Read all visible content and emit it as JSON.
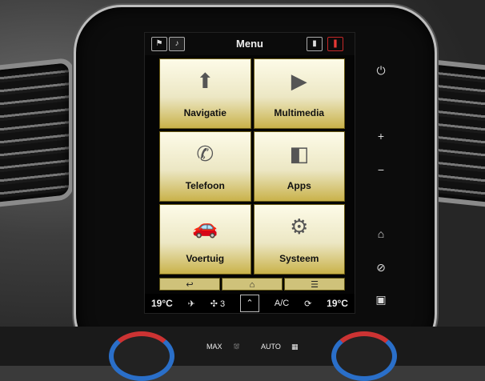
{
  "header": {
    "title": "Menu",
    "left_icons": [
      "road-sign-icon",
      "audio-icon"
    ],
    "right_icons": [
      "phone-battery-icon",
      "signal-icon"
    ]
  },
  "tiles": [
    {
      "label": "Navigatie",
      "icon": "navigation-arrow-icon",
      "glyph": "⬆"
    },
    {
      "label": "Multimedia",
      "icon": "play-icon",
      "glyph": "▶"
    },
    {
      "label": "Telefoon",
      "icon": "phone-icon",
      "glyph": "✆"
    },
    {
      "label": "Apps",
      "icon": "apps-icon",
      "glyph": "◧"
    },
    {
      "label": "Voertuig",
      "icon": "car-icon",
      "glyph": "🚗"
    },
    {
      "label": "Systeem",
      "icon": "gear-icon",
      "glyph": "⚙"
    }
  ],
  "nav_strip": {
    "back": "↩",
    "home": "⌂",
    "list": "☰"
  },
  "climate": {
    "left_temp": "19°C",
    "fan_speed": "3",
    "ac": "A/C",
    "right_temp": "19°C"
  },
  "side_controls": {
    "power": "⏻",
    "plus": "+",
    "minus": "−",
    "home": "⌂"
  },
  "console": {
    "max": "MAX",
    "auto": "AUTO"
  },
  "colors": {
    "tile_gold": "#c9b24a",
    "accent_red": "#e53935"
  }
}
